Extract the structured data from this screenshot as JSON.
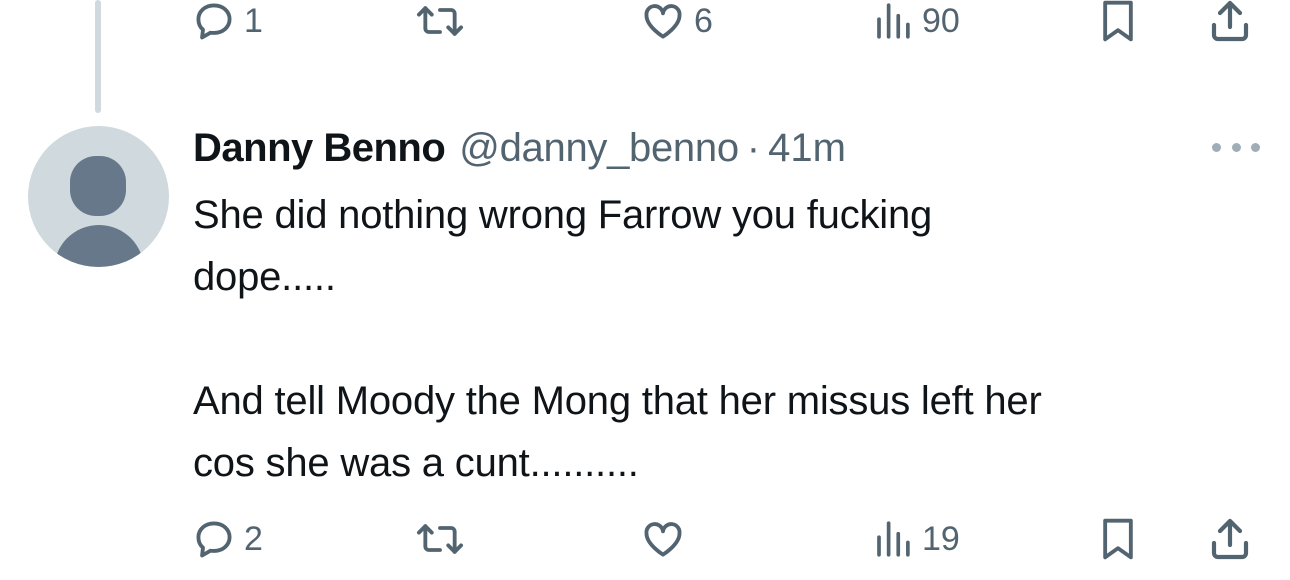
{
  "previous_tweet": {
    "actions": {
      "reply_count": "1",
      "retweet_count": "",
      "like_count": "6",
      "views_count": "90"
    }
  },
  "tweet": {
    "display_name": "Danny Benno",
    "handle": "@danny_benno",
    "separator": "·",
    "time": "41m",
    "text": "She did nothing wrong Farrow you fucking\ndope.....\n\nAnd tell Moody the Mong that her missus left her\ncos she was a cunt..........",
    "actions": {
      "reply_count": "2",
      "retweet_count": "",
      "like_count": "",
      "views_count": "19"
    }
  },
  "icons": {
    "reply": "reply-icon",
    "retweet": "retweet-icon",
    "like": "heart-icon",
    "views": "views-icon",
    "bookmark": "bookmark-icon",
    "share": "share-icon",
    "more": "more-icon",
    "avatar": "default-avatar"
  },
  "colors": {
    "text_primary": "#0f1419",
    "text_secondary": "#536471",
    "thread_line": "#cfd9de",
    "avatar_bg": "#cfd9de",
    "avatar_fg": "#66788a"
  }
}
